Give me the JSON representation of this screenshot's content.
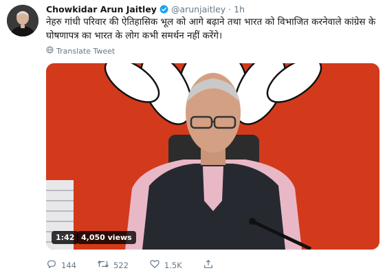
{
  "tweet": {
    "display_name": "Chowkidar Arun Jaitley",
    "handle": "@arunjaitley",
    "separator": "·",
    "time": "1h",
    "text": "नेहरु गांधी परिवार की ऐतिहासिक भूल को आगे बढ़ाने तथा भारत को विभाजित करनेवाले कांग्रेस के घोषणापत्र का भारत के लोग कभी समर्थन नहीं करेंगे।",
    "translate_label": "Translate Tweet"
  },
  "video": {
    "duration": "1:42",
    "views": "4,050 views"
  },
  "actions": {
    "replies": "144",
    "retweets": "522",
    "likes": "1.5K"
  },
  "colors": {
    "verified": "#1da1f2",
    "video_bg": "#d33a1b",
    "muted_text": "#657786"
  },
  "icons": [
    "verified-badge-icon",
    "globe-icon",
    "reply-icon",
    "retweet-icon",
    "like-icon",
    "share-icon"
  ]
}
